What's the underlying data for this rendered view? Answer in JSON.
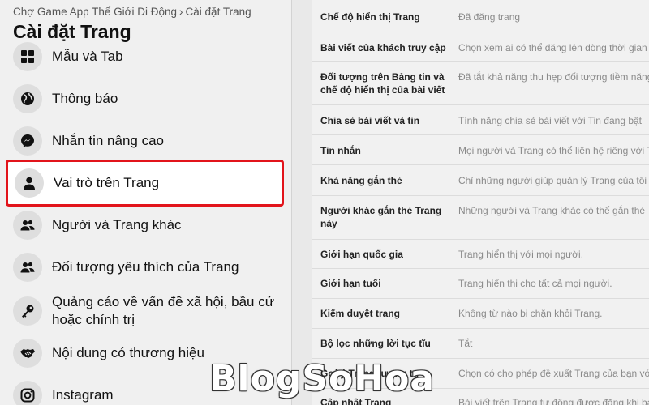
{
  "breadcrumb": {
    "part1": "Chợ Game App Thế Giới Di Động",
    "separator": "›",
    "part2": "Cài đặt Trang"
  },
  "page_title": "Cài đặt Trang",
  "sidebar": {
    "items": [
      {
        "label": "Mẫu và Tab",
        "icon": "grid-icon"
      },
      {
        "label": "Thông báo",
        "icon": "globe-icon"
      },
      {
        "label": "Nhắn tin nâng cao",
        "icon": "messenger-icon"
      },
      {
        "label": "Vai trò trên Trang",
        "icon": "person-icon",
        "active": true
      },
      {
        "label": "Người và Trang khác",
        "icon": "people-icon"
      },
      {
        "label": "Đối tượng yêu thích của Trang",
        "icon": "people-icon"
      },
      {
        "label": "Quảng cáo về vấn đề xã hội, bầu cử hoặc chính trị",
        "icon": "key-icon"
      },
      {
        "label": "Nội dung có thương hiệu",
        "icon": "handshake-icon"
      },
      {
        "label": "Instagram",
        "icon": "instagram-icon"
      }
    ]
  },
  "settings": {
    "rows": [
      {
        "name": "Chế độ hiển thị Trang",
        "value": "Đã đăng trang"
      },
      {
        "name": "Bài viết của khách truy cập",
        "value": "Chọn xem ai có thể đăng lên dòng thời gian"
      },
      {
        "name": "Đối tượng trên Bảng tin và chế độ hiển thị của bài viết",
        "value": "Đã tắt khả năng thu hẹp đối tượng tiềm năng"
      },
      {
        "name": "Chia sẻ bài viết và tin",
        "value": "Tính năng chia sẻ bài viết với Tin đang bật"
      },
      {
        "name": "Tin nhắn",
        "value": "Mọi người và Trang có thể liên hệ riêng với Trang"
      },
      {
        "name": "Khả năng gắn thẻ",
        "value": "Chỉ những người giúp quản lý Trang của tôi"
      },
      {
        "name": "Người khác gắn thẻ Trang này",
        "value": "Những người và Trang khác có thể gắn thẻ"
      },
      {
        "name": "Giới hạn quốc gia",
        "value": "Trang hiển thị với mọi người."
      },
      {
        "name": "Giới hạn tuổi",
        "value": "Trang hiển thị cho tất cả mọi người."
      },
      {
        "name": "Kiểm duyệt trang",
        "value": "Không từ nào bị chặn khỏi Trang."
      },
      {
        "name": "Bộ lọc những lời tục tĩu",
        "value": "Tắt"
      },
      {
        "name": "Gợi ý Trang tương tự",
        "value": "Chọn có cho phép đề xuất Trang của bạn với người khác"
      },
      {
        "name": "Cập nhật Trang",
        "value": "Bài viết trên Trang tự động được đăng khi bạn"
      }
    ]
  },
  "watermark": "BlogSoHoa",
  "colors": {
    "highlight_border": "#e2141b",
    "sidebar_bg": "#f0f0f0",
    "content_bg": "#f1f1f1"
  }
}
